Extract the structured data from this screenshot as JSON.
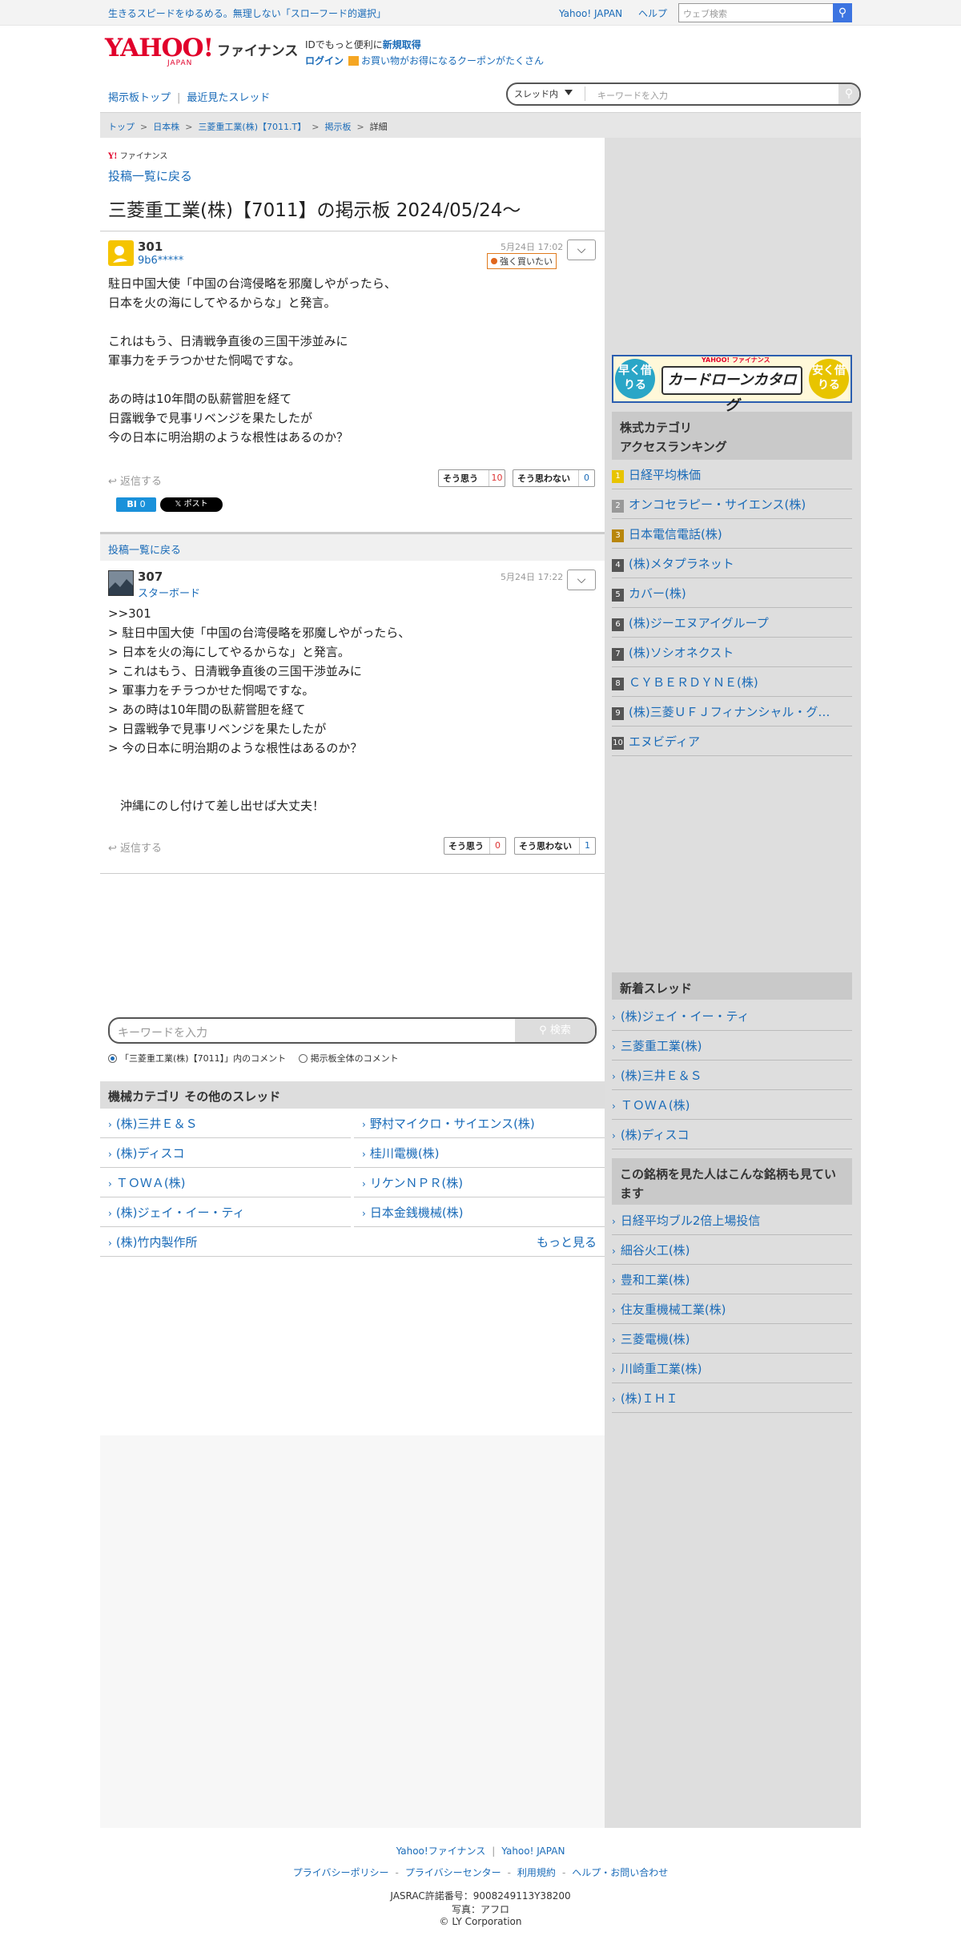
{
  "topbar": {
    "slogan": "生きるスピードをゆるめる。無理しない「スローフード的選択」",
    "link_yahoo": "Yahoo! JAPAN",
    "link_help": "ヘルプ",
    "web_search_placeholder": "ウェブ検索"
  },
  "header": {
    "logo_text": "YAHOO!",
    "logo_sub": "JAPAN",
    "service_name": "ファイナンス",
    "id_text": "IDでもっと便利に",
    "signup": "新規取得",
    "login": "ログイン",
    "coupon_text": "お買い物がお得になるクーポンがたくさん"
  },
  "subnav": {
    "board_top": "掲示板トップ",
    "recent": "最近見たスレッド",
    "search_scope": "スレッド内",
    "search_placeholder": "キーワードを入力"
  },
  "breadcrumb": [
    "トップ",
    "日本株",
    "三菱重工業(株)【7011.T】",
    "掲示板",
    "詳細"
  ],
  "page": {
    "small_brand": "ファイナンス",
    "back_label": "投稿一覧に戻る",
    "title": "三菱重工業(株)【7011】の掲示板 2024/05/24〜"
  },
  "posts": [
    {
      "number": "301",
      "user": "9b6*****",
      "date": "5月24日 17:02",
      "sentiment": "強く買いたい",
      "body": "駐日中国大使「中国の台湾侵略を邪魔しやがったら、\n日本を火の海にしてやるからな」と発言。\n\nこれはもう、日清戦争直後の三国干渉並みに\n軍事力をチラつかせた恫喝ですな。\n\nあの時は10年間の臥薪嘗胆を経て\n日露戦争で見事リベンジを果たしたが\n今の日本に明治期のような根性はあるのか？",
      "reply": "返信する",
      "agree_label": "そう思う",
      "agree_count": "10",
      "disagree_label": "そう思わない",
      "disagree_count": "0",
      "bi_label": "BI",
      "bi_count": "0",
      "x_post": "ポスト"
    },
    {
      "number": "307",
      "user": "スターボード",
      "date": "5月24日 17:22",
      "body": ">>301\n> 駐日中国大使「中国の台湾侵略を邪魔しやがったら、\n> 日本を火の海にしてやるからな」と発言。\n> これはもう、日清戦争直後の三国干渉並みに\n> 軍事力をチラつかせた恫喝ですな。\n> あの時は10年間の臥薪嘗胆を経て\n> 日露戦争で見事リベンジを果たしたが\n> 今の日本に明治期のような根性はあるのか？\n\n\n　沖縄にのし付けて差し出せば大丈夫！",
      "reply": "返信する",
      "agree_label": "そう思う",
      "agree_count": "0",
      "disagree_label": "そう思わない",
      "disagree_count": "1"
    }
  ],
  "bottom_search": {
    "placeholder": "キーワードを入力",
    "button": "検索",
    "radio_thread": "「三菱重工業(株)【7011】」内のコメント",
    "radio_all": "掲示板全体のコメント"
  },
  "category": {
    "heading": "機械カテゴリ その他のスレッド",
    "items": [
      "(株)三井Ｅ＆Ｓ",
      "野村マイクロ・サイエンス(株)",
      "(株)ディスコ",
      "桂川電機(株)",
      "ＴＯＷＡ(株)",
      "リケンＮＰＲ(株)",
      "(株)ジェイ・イー・ティ",
      "日本金銭機械(株)",
      "(株)竹内製作所"
    ],
    "more": "もっと見る"
  },
  "ad": {
    "left": "早く借りる",
    "right": "安く借りる",
    "label": "カードローンカタログ",
    "brand": "YAHOO! ファイナンス"
  },
  "ranking": {
    "heading_line1": "株式カテゴリ",
    "heading_line2": "アクセスランキング",
    "items": [
      "日経平均株価",
      "オンコセラピー・サイエンス(株)",
      "日本電信電話(株)",
      "(株)メタプラネット",
      "カバー(株)",
      "(株)ジーエヌアイグループ",
      "(株)ソシオネクスト",
      "ＣＹＢＥＲＤＹＮＥ(株)",
      "(株)三菱ＵＦＪフィナンシャル・グ…",
      "エヌビディア"
    ],
    "numbers": [
      "1",
      "2",
      "3",
      "4",
      "5",
      "6",
      "7",
      "8",
      "9",
      "10"
    ]
  },
  "new_threads": {
    "heading": "新着スレッド",
    "items": [
      "(株)ジェイ・イー・ティ",
      "三菱重工業(株)",
      "(株)三井Ｅ＆Ｓ",
      "ＴＯＷＡ(株)",
      "(株)ディスコ"
    ]
  },
  "also_viewed": {
    "heading": "この銘柄を見た人はこんな銘柄も見ています",
    "items": [
      "日経平均ブル2倍上場投信",
      "細谷火工(株)",
      "豊和工業(株)",
      "住友重機械工業(株)",
      "三菱電機(株)",
      "川崎重工業(株)",
      "(株)ＩＨＩ"
    ]
  },
  "footer": {
    "l1": [
      "Yahoo!ファイナンス",
      "Yahoo! JAPAN"
    ],
    "l2": [
      "プライバシーポリシー",
      "プライバシーセンター",
      "利用規約",
      "ヘルプ・お問い合わせ"
    ],
    "jasrac": "JASRAC許諾番号：9008249113Y38200",
    "photo": "写真：アフロ",
    "copyright": "© LY Corporation"
  },
  "colors": {
    "accent": "#1a6bb8",
    "brand_red": "#e1002b",
    "sidebar_bg": "#dedede"
  }
}
